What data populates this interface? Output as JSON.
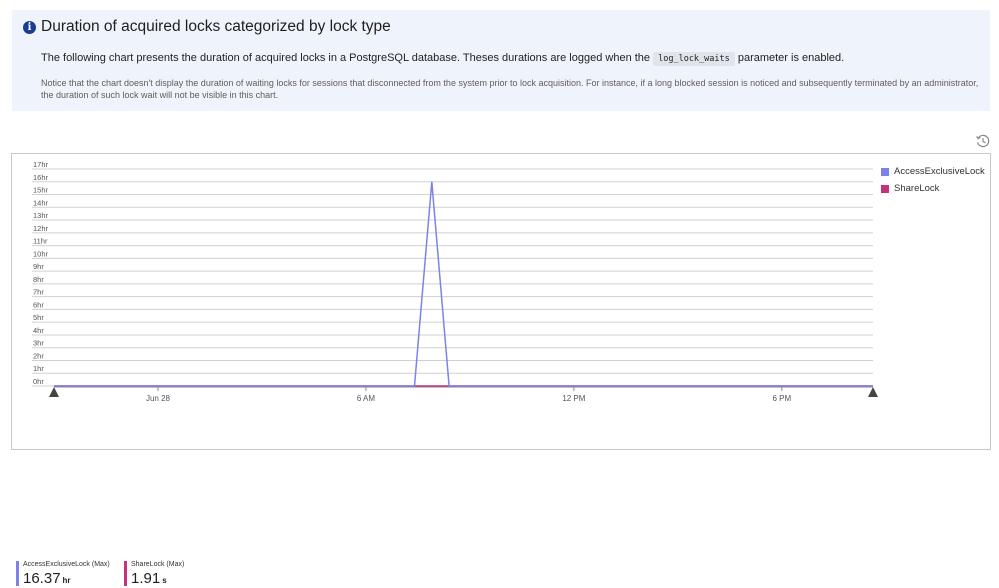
{
  "info": {
    "icon": "info-icon",
    "title": "Duration of acquired locks categorized by lock type",
    "description_before": "The following chart presents the duration of acquired locks in a PostgreSQL database. Theses durations are logged when the",
    "code": "log_lock_waits",
    "description_after": "parameter is enabled.",
    "note": "Notice that the chart doesn't display the duration of waiting locks for sessions that disconnected from the system prior to lock acquisition. For instance, if a long blocked session is noticed and subsequently terminated by an administrator, the duration of such lock wait will not be visible in this chart."
  },
  "toolbar": {
    "history_icon": "history-icon"
  },
  "legend": [
    {
      "label": "AccessExclusiveLock",
      "color": "#7b83eb"
    },
    {
      "label": "ShareLock",
      "color": "#c4317d"
    }
  ],
  "summary": [
    {
      "label": "AccessExclusiveLock (Max)",
      "value": "16.37",
      "unit": "hr",
      "color": "#7b83eb"
    },
    {
      "label": "ShareLock (Max)",
      "value": "1.91",
      "unit": "s",
      "color": "#c4317d"
    }
  ],
  "chart_data": {
    "type": "line",
    "y_ticks": [
      "0hr",
      "1hr",
      "2hr",
      "3hr",
      "4hr",
      "5hr",
      "6hr",
      "7hr",
      "8hr",
      "9hr",
      "10hr",
      "11hr",
      "12hr",
      "13hr",
      "14hr",
      "15hr",
      "16hr",
      "17hr"
    ],
    "ylim": [
      0,
      17
    ],
    "y_unit": "hr",
    "x_ticks": [
      {
        "label": "Jun 28",
        "t": 5
      },
      {
        "label": "6 AM",
        "t": 11
      },
      {
        "label": "12 PM",
        "t": 17
      },
      {
        "label": "6 PM",
        "t": 23
      }
    ],
    "xlim": [
      2,
      25.63
    ],
    "series": [
      {
        "name": "AccessExclusiveLock",
        "color": "#7b83eb",
        "x": [
          2,
          12.4,
          12.9,
          13.4,
          25.63
        ],
        "y": [
          0,
          0,
          16,
          0,
          0
        ]
      },
      {
        "name": "ShareLock",
        "color": "#c4317d",
        "x": [
          2,
          25.63
        ],
        "y": [
          0,
          0
        ]
      }
    ],
    "grid": true,
    "legend_position": "right"
  }
}
